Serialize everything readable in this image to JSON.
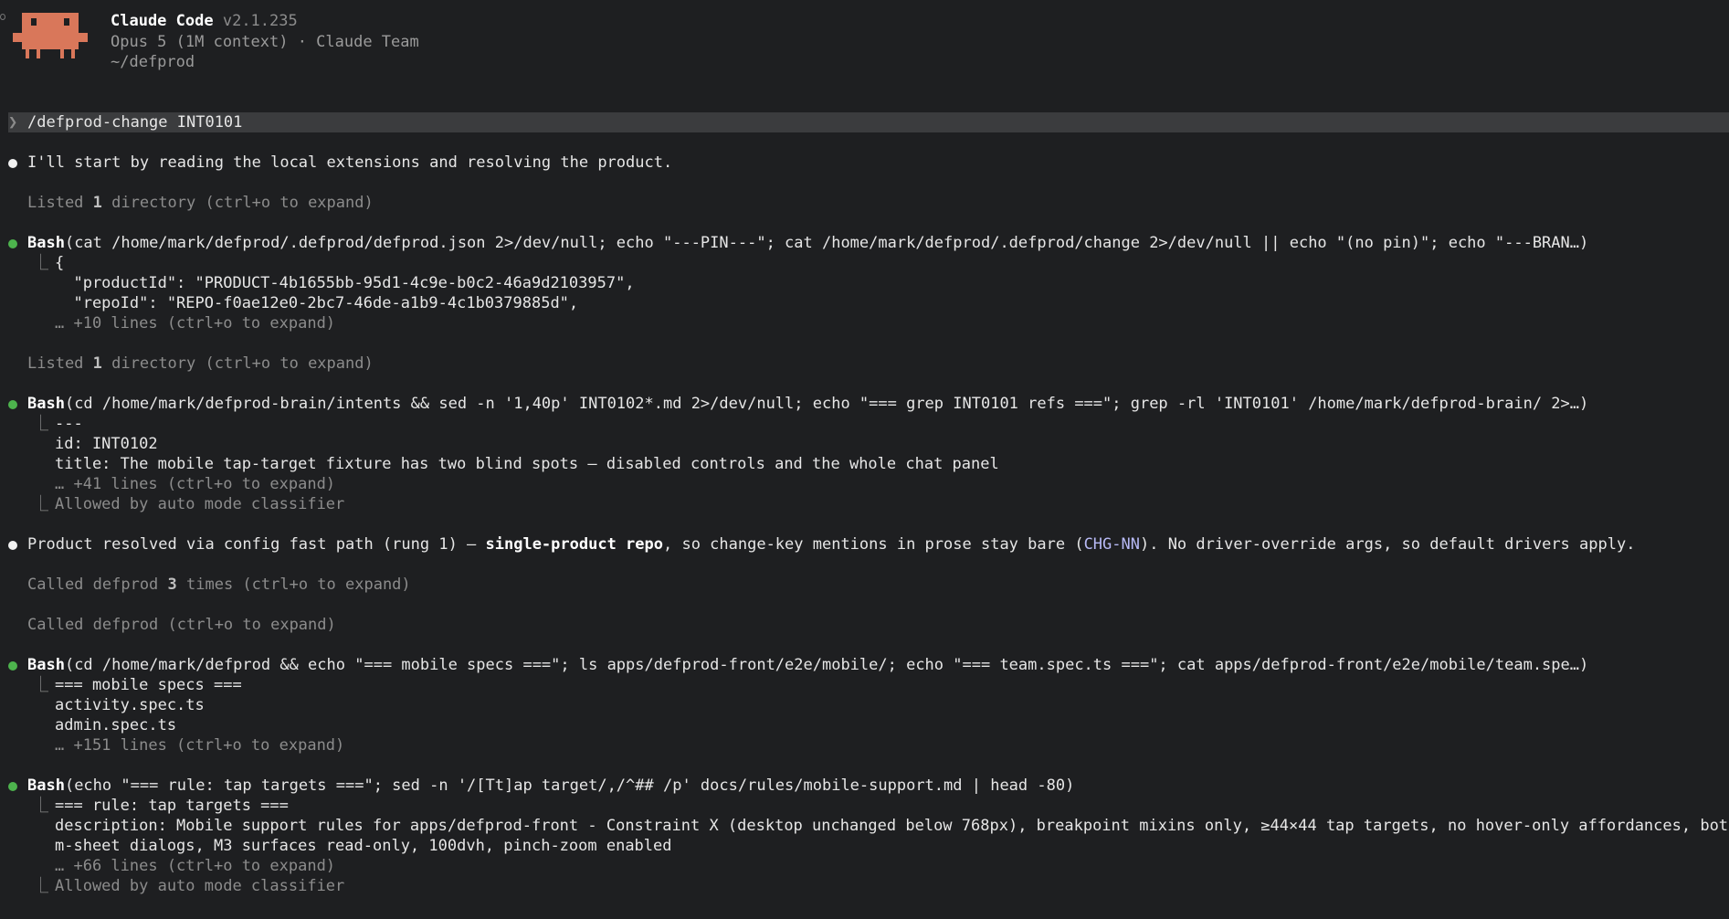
{
  "header": {
    "app_name": "Claude Code",
    "version": "v2.1.235",
    "model_info": "Opus 5 (1M context) · Claude Team",
    "cwd": "~/defprod",
    "logo_icon": "claude-crab-pixel-logo",
    "logo_color": "#d9775a"
  },
  "prompt": {
    "glyph": "❯",
    "command": "/defprod-change INT0101"
  },
  "colors": {
    "background": "#1e1f21",
    "prompt_bar": "#3b3c3e",
    "success_dot": "#4db34d",
    "text_dot": "#f2f2f2",
    "link": "#b7b9f5"
  },
  "transcript": {
    "msg1": "I'll start by reading the local extensions and resolving the product.",
    "listed1": {
      "pre": "Listed ",
      "count": "1",
      "post": " directory (ctrl+o to expand)"
    },
    "bash1": {
      "tool": "Bash",
      "command": "(cat /home/mark/defprod/.defprod/defprod.json 2>/dev/null; echo \"---PIN---\"; cat /home/mark/defprod/.defprod/change 2>/dev/null || echo \"(no pin)\"; echo \"---BRAN…)",
      "out1": "{",
      "out2": "  \"productId\": \"PRODUCT-4b1655bb-95d1-4c9e-b0c2-46a9d2103957\",",
      "out3": "  \"repoId\": \"REPO-f0ae12e0-2bc7-46de-a1b9-4c1b0379885d\",",
      "more": "… +10 lines (ctrl+o to expand)"
    },
    "listed2": {
      "pre": "Listed ",
      "count": "1",
      "post": " directory (ctrl+o to expand)"
    },
    "bash2": {
      "tool": "Bash",
      "command": "(cd /home/mark/defprod-brain/intents && sed -n '1,40p' INT0102*.md 2>/dev/null; echo \"=== grep INT0101 refs ===\"; grep -rl 'INT0101' /home/mark/defprod-brain/ 2>…)",
      "out1": "---",
      "out2": "id: INT0102",
      "out3": "title: The mobile tap-target fixture has two blind spots — disabled controls and the whole chat panel",
      "more": "… +41 lines (ctrl+o to expand)",
      "allowed": "Allowed by auto mode classifier"
    },
    "msg2": {
      "pre": "Product resolved via config fast path (rung 1) — ",
      "bold": "single-product repo",
      "mid": ", so change-key mentions in prose stay bare (",
      "link": "CHG-NN",
      "post": "). No driver-override args, so default drivers apply."
    },
    "called1": {
      "pre": "Called defprod ",
      "count": "3",
      "post": " times (ctrl+o to expand)"
    },
    "called2": "Called defprod (ctrl+o to expand)",
    "bash3": {
      "tool": "Bash",
      "command": "(cd /home/mark/defprod && echo \"=== mobile specs ===\"; ls apps/defprod-front/e2e/mobile/; echo \"=== team.spec.ts ===\"; cat apps/defprod-front/e2e/mobile/team.spe…)",
      "out1": "=== mobile specs ===",
      "out2": "activity.spec.ts",
      "out3": "admin.spec.ts",
      "more": "… +151 lines (ctrl+o to expand)"
    },
    "bash4": {
      "tool": "Bash",
      "command": "(echo \"=== rule: tap targets ===\"; sed -n '/[Tt]ap target/,/^## /p' docs/rules/mobile-support.md | head -80)",
      "out1": "=== rule: tap targets ===",
      "out2": "description: Mobile support rules for apps/defprod-front - Constraint X (desktop unchanged below 768px), breakpoint mixins only, ≥44×44 tap targets, no hover-only affordances, botto",
      "out3": "m-sheet dialogs, M3 surfaces read-only, 100dvh, pinch-zoom enabled",
      "more": "… +66 lines (ctrl+o to expand)",
      "allowed": "Allowed by auto mode classifier"
    }
  }
}
